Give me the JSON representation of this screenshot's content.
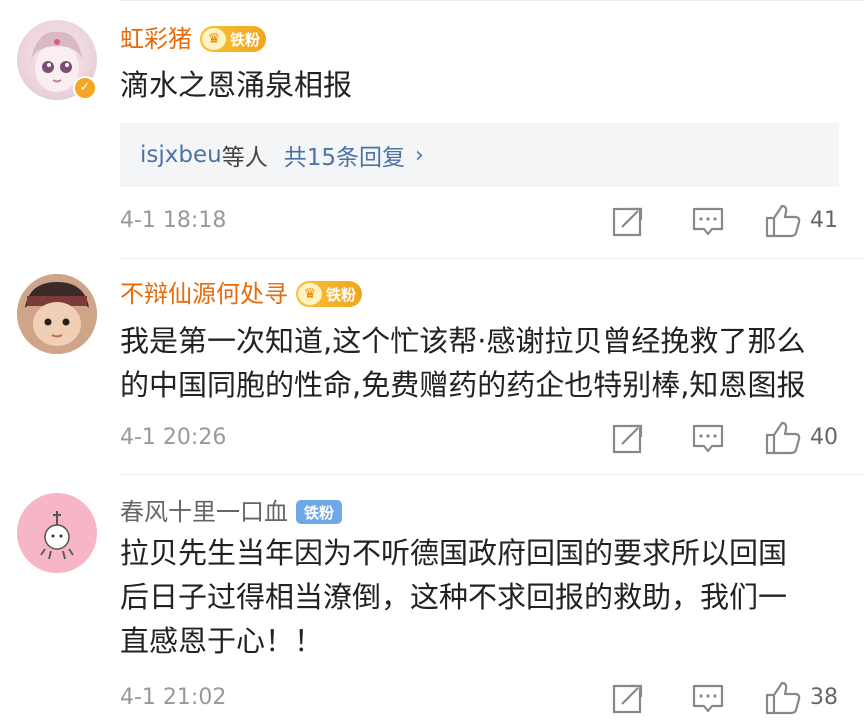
{
  "comments": [
    {
      "username": "虹彩猪",
      "badge": "铁粉",
      "verified": true,
      "text": "滴水之恩涌泉相报",
      "reply_preview": {
        "user": "isjxbeu",
        "suffix": "等人",
        "count": "共15条回复",
        "chevron": "›"
      },
      "time": "4-1 18:18",
      "likes": "41"
    },
    {
      "username": "不辩仙源何处寻",
      "badge": "铁粉",
      "verified": false,
      "text": "我是第一次知道,这个忙该帮·感谢拉贝曾经挽救了那么\n的中国同胞的性命,免费赠药的药企也特别棒,知恩图报",
      "time": "4-1 20:26",
      "likes": "40"
    },
    {
      "username": "春风十里一口血",
      "badge": "铁粉",
      "verified": false,
      "text": "拉贝先生当年因为不听德国政府回国的要求所以回国\n后日子过得相当潦倒，这种不求回报的救助，我们一\n直感恩于心！！",
      "time": "4-1 21:02",
      "likes": "38"
    }
  ],
  "colors": {
    "gold_name": "#e86b0c",
    "link": "#4c73a6",
    "gray": "#999999"
  },
  "icons": [
    "share-icon",
    "comment-icon",
    "like-icon",
    "crown-icon",
    "verified-icon"
  ]
}
